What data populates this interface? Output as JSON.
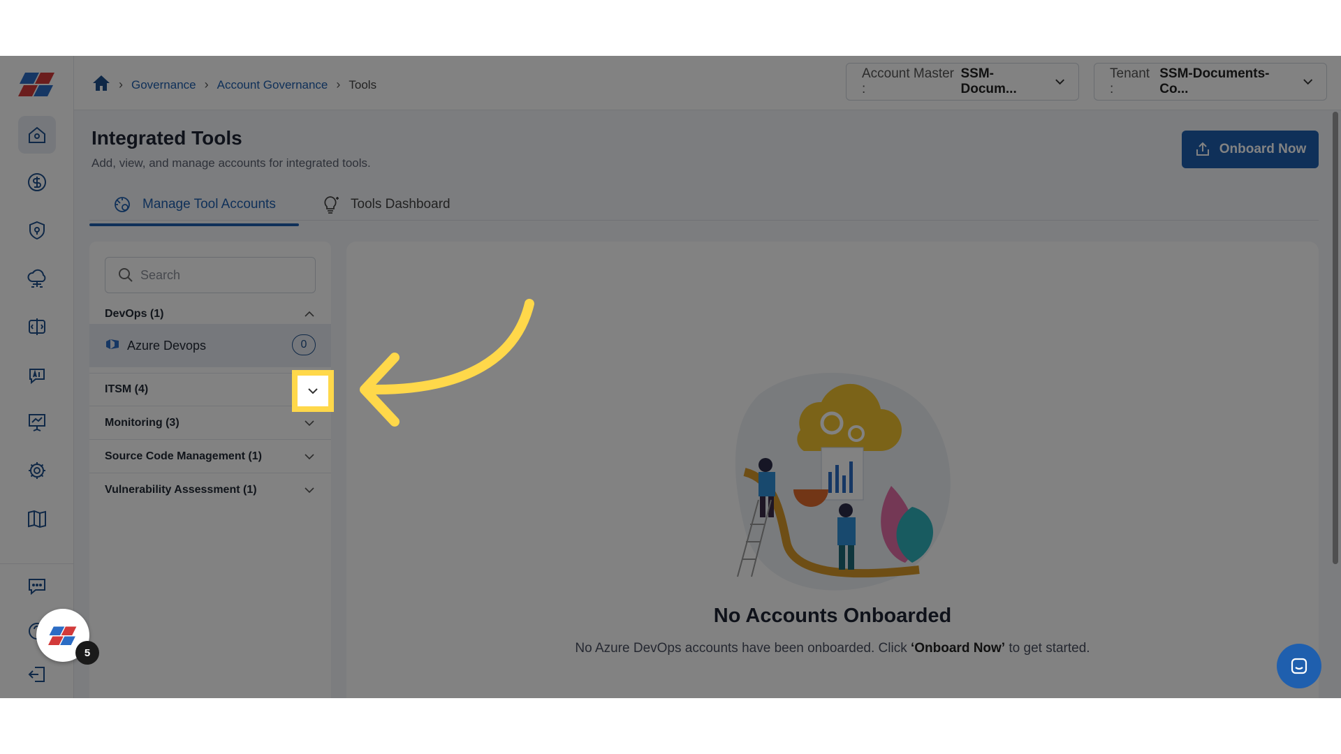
{
  "header": {
    "breadcrumb": [
      "Governance",
      "Account Governance",
      "Tools"
    ],
    "account_master_label": "Account Master :",
    "account_master_value": "SSM-Docum...",
    "tenant_label": "Tenant :",
    "tenant_value": "SSM-Documents-Co..."
  },
  "page": {
    "title": "Integrated Tools",
    "subtitle": "Add, view, and manage accounts for integrated tools.",
    "onboard_button": "Onboard Now"
  },
  "tabs": [
    {
      "label": "Manage Tool Accounts",
      "icon": "gear-tools-icon",
      "active": true
    },
    {
      "label": "Tools Dashboard",
      "icon": "lightbulb-icon",
      "active": false
    }
  ],
  "sidebar": {
    "search_placeholder": "Search",
    "categories": [
      {
        "label": "DevOps (1)",
        "expanded": true,
        "items": [
          {
            "label": "Azure Devops",
            "count": "0"
          }
        ]
      },
      {
        "label": "ITSM (4)",
        "expanded": false
      },
      {
        "label": "Monitoring (3)",
        "expanded": false
      },
      {
        "label": "Source Code Management (1)",
        "expanded": false
      },
      {
        "label": "Vulnerability Assessment (1)",
        "expanded": false
      }
    ]
  },
  "empty_state": {
    "title": "No Accounts Onboarded",
    "message_prefix": "No Azure DevOps accounts have been onboarded. Click",
    "message_bold": "‘Onboard Now’",
    "message_suffix": "to get started."
  },
  "widgets": {
    "badge_count": "5"
  },
  "colors": {
    "accent": "#1f5fae",
    "highlight": "#ffd84a"
  }
}
